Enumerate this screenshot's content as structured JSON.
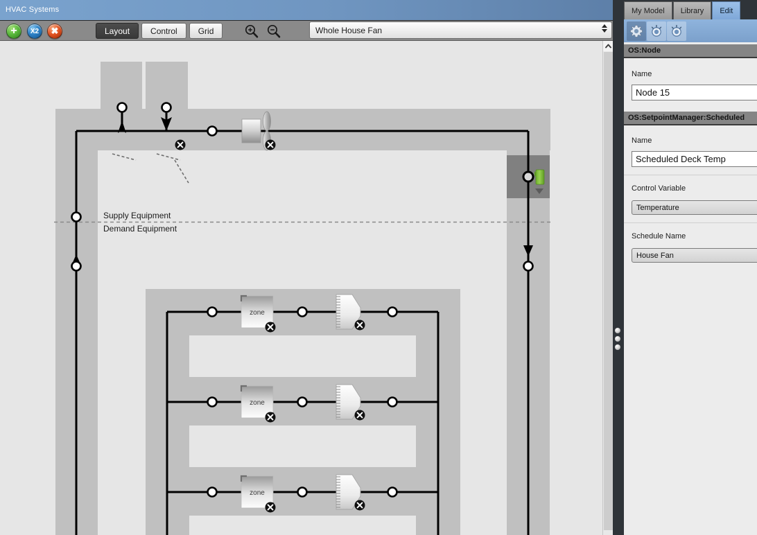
{
  "window": {
    "title": "HVAC Systems"
  },
  "toolbar": {
    "add_label": "+",
    "duplicate_label": "X2",
    "delete_label": "✖",
    "segments": [
      {
        "label": "Layout",
        "active": true
      },
      {
        "label": "Control",
        "active": false
      },
      {
        "label": "Grid",
        "active": false
      }
    ],
    "zoom_in_icon": "zoom-in-icon",
    "zoom_out_icon": "zoom-out-icon",
    "loop_selector": {
      "value": "Whole House Fan"
    }
  },
  "canvas": {
    "supply_label": "Supply Equipment",
    "demand_label": "Demand Equipment",
    "zone_label": "zone",
    "zones": [
      {
        "label": "zone"
      },
      {
        "label": "zone"
      },
      {
        "label": "zone"
      }
    ],
    "selected_node_highlight": "#808080",
    "setpoint_marker_color": "#7ac143",
    "loop_band_color": "#c0c0c0",
    "canvas_bg": "#e6e6e6"
  },
  "right_panel": {
    "tabs": [
      {
        "label": "My Model",
        "active": false
      },
      {
        "label": "Library",
        "active": false
      },
      {
        "label": "Edit",
        "active": true
      }
    ],
    "icons": [
      {
        "name": "gear-icon",
        "state": "selected"
      },
      {
        "name": "measure-knob-icon",
        "state": "lit"
      },
      {
        "name": "measure-knob-icon",
        "state": "lit"
      }
    ],
    "sections": [
      {
        "header": "OS:Node",
        "fields": [
          {
            "label": "Name",
            "kind": "text",
            "value": "Node 15"
          }
        ]
      },
      {
        "header": "OS:SetpointManager:Scheduled",
        "fields": [
          {
            "label": "Name",
            "kind": "text",
            "value": "Scheduled Deck Temp"
          },
          {
            "label": "Control Variable",
            "kind": "dropdown",
            "value": "Temperature"
          },
          {
            "label": "Schedule Name",
            "kind": "dropdown",
            "value": "House Fan"
          }
        ]
      }
    ]
  }
}
